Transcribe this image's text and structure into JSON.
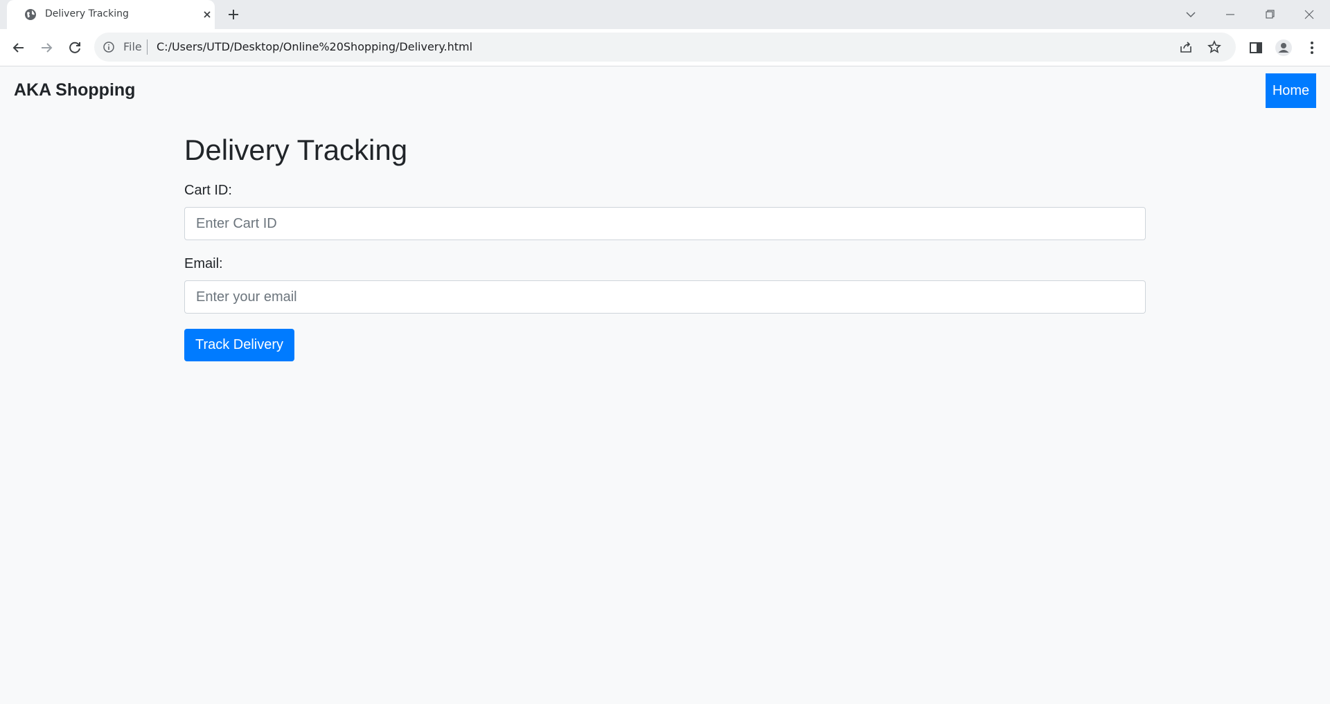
{
  "browser": {
    "tab_title": "Delivery Tracking",
    "address_scheme": "File",
    "address_url": "C:/Users/UTD/Desktop/Online%20Shopping/Delivery.html",
    "icons": [
      "globe-icon",
      "close-icon",
      "plus-icon",
      "chevron-down-icon",
      "minimize-icon",
      "restore-icon",
      "window-close-icon",
      "back-icon",
      "forward-icon",
      "reload-icon",
      "info-icon",
      "share-icon",
      "star-icon",
      "side-panel-icon",
      "profile-icon",
      "menu-icon"
    ]
  },
  "nav": {
    "brand": "AKA Shopping",
    "home_label": "Home"
  },
  "form": {
    "title": "Delivery Tracking",
    "cart_label": "Cart ID:",
    "cart_placeholder": "Enter Cart ID",
    "email_label": "Email:",
    "email_placeholder": "Enter your email",
    "submit_label": "Track Delivery"
  },
  "colors": {
    "primary": "#007bff",
    "page_bg": "#f8f9fa",
    "text": "#212529"
  }
}
